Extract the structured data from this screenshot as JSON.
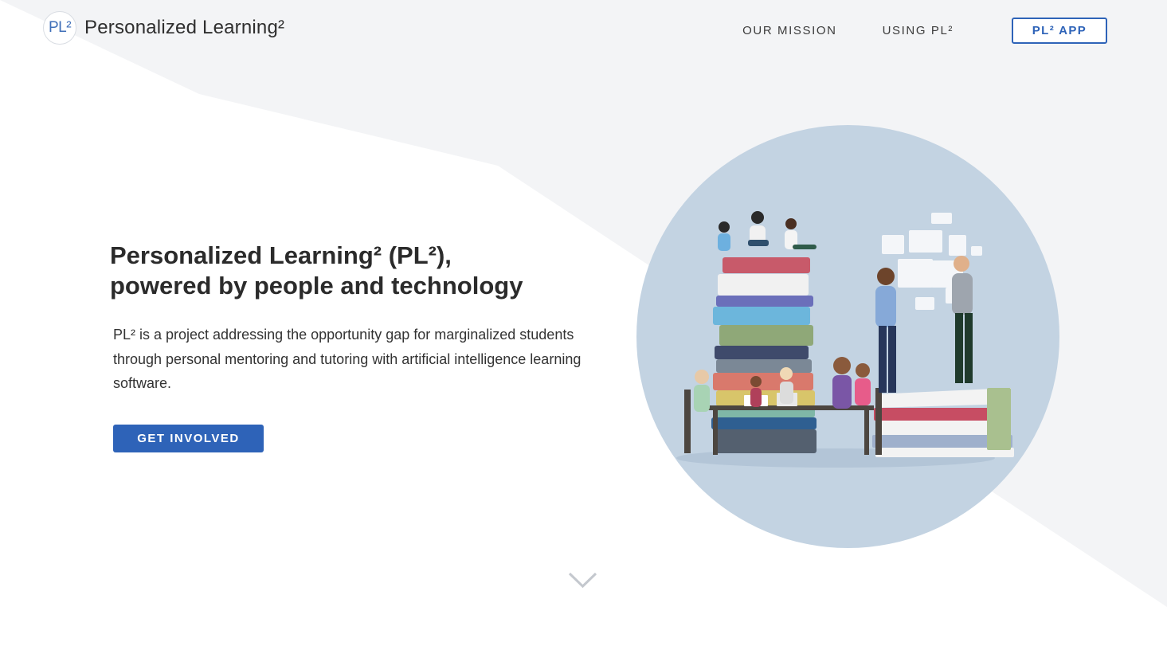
{
  "header": {
    "logo_mark": "PL²",
    "logo_text": "Personalized Learning²",
    "nav": [
      {
        "label": "OUR MISSION"
      },
      {
        "label": "USING PL²"
      }
    ],
    "app_button": "PL² APP"
  },
  "hero": {
    "title_line1": "Personalized Learning² (PL²),",
    "title_line2": "powered by people and technology",
    "description": "PL² is a project addressing the opportunity gap for marginalized students through personal mentoring and tutoring with artificial intelligence learning software.",
    "cta_label": "GET INVOLVED"
  },
  "colors": {
    "accent": "#2e63b8",
    "background_shape": "#f3f4f6",
    "illustration_circle": "#c3d3e2"
  },
  "icons": {
    "scroll": "chevron-down-icon",
    "illustration": "people-studying-on-books-illustration"
  }
}
